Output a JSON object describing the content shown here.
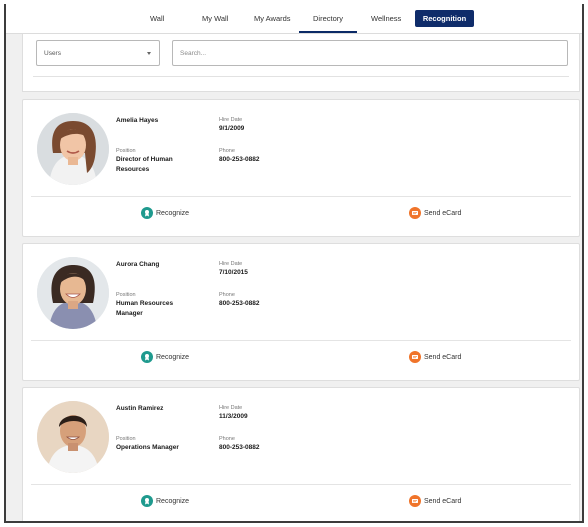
{
  "nav": {
    "items": [
      "Wall",
      "My Wall",
      "My Awards",
      "Directory",
      "Wellness"
    ],
    "active": "Directory",
    "button_label": "Recognition"
  },
  "filter": {
    "select_value": "Users",
    "search_placeholder": "Search..."
  },
  "labels": {
    "hire_date": "Hire Date",
    "position": "Position",
    "phone": "Phone",
    "recognize": "Recognize",
    "send_ecard": "Send eCard"
  },
  "employees": [
    {
      "name": "Amelia Hayes",
      "hire_date": "9/1/2009",
      "position": "Director of Human Resources",
      "phone": "800-253-0882"
    },
    {
      "name": "Aurora Chang",
      "hire_date": "7/10/2015",
      "position": "Human Resources Manager",
      "phone": "800-253-0882"
    },
    {
      "name": "Austin Ramirez",
      "hire_date": "11/3/2009",
      "position": "Operations Manager",
      "phone": "800-253-0882"
    }
  ],
  "colors": {
    "nav_accent": "#0f2c6a",
    "recognize_icon": "#1f9a8e",
    "ecard_icon": "#f0742a"
  }
}
